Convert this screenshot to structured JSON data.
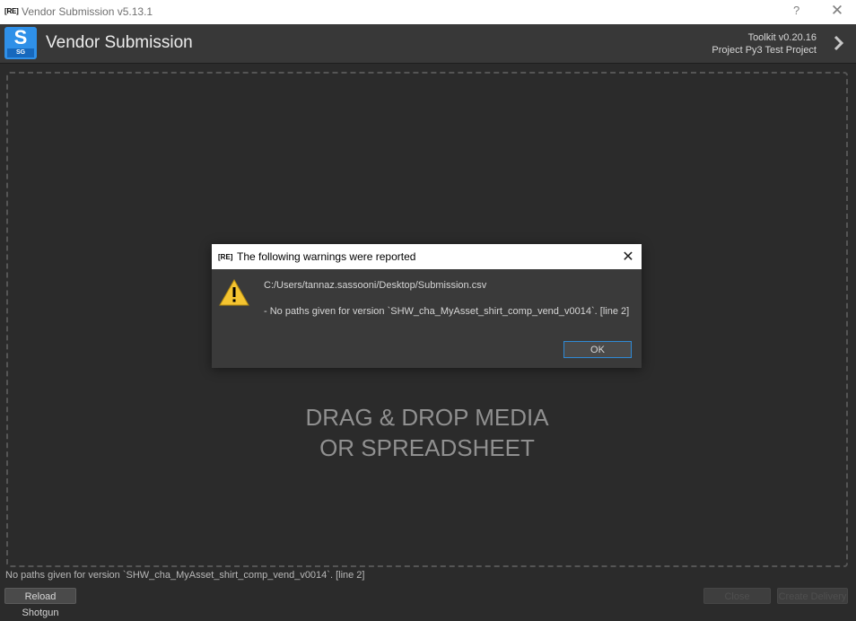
{
  "window": {
    "badge": "[RE]",
    "title": "Vendor Submission v5.13.1",
    "help_label": "?",
    "close_label": "✕"
  },
  "header": {
    "logo_letter": "S",
    "logo_sub": "SG",
    "app_name": "Vendor Submission",
    "toolkit_version": "Toolkit v0.20.16",
    "project": "Project Py3 Test Project"
  },
  "dropzone": {
    "line1": "DRAG & DROP MEDIA",
    "line2": "OR SPREADSHEET"
  },
  "status": {
    "text": "No paths given for version `SHW_cha_MyAsset_shirt_comp_vend_v0014`. [line 2]"
  },
  "buttons": {
    "reload": "Reload Shotgun",
    "close": "Close",
    "create": "Create Delivery"
  },
  "dialog": {
    "badge": "[RE]",
    "title": "The following warnings were reported",
    "close_label": "✕",
    "path": "C:/Users/tannaz.sassooni/Desktop/Submission.csv",
    "message": " - No paths given for version `SHW_cha_MyAsset_shirt_comp_vend_v0014`. [line 2]",
    "ok_label": "OK"
  },
  "colors": {
    "accent": "#2f90e8",
    "warning": "#f4c430",
    "background": "#2b2b2b"
  }
}
